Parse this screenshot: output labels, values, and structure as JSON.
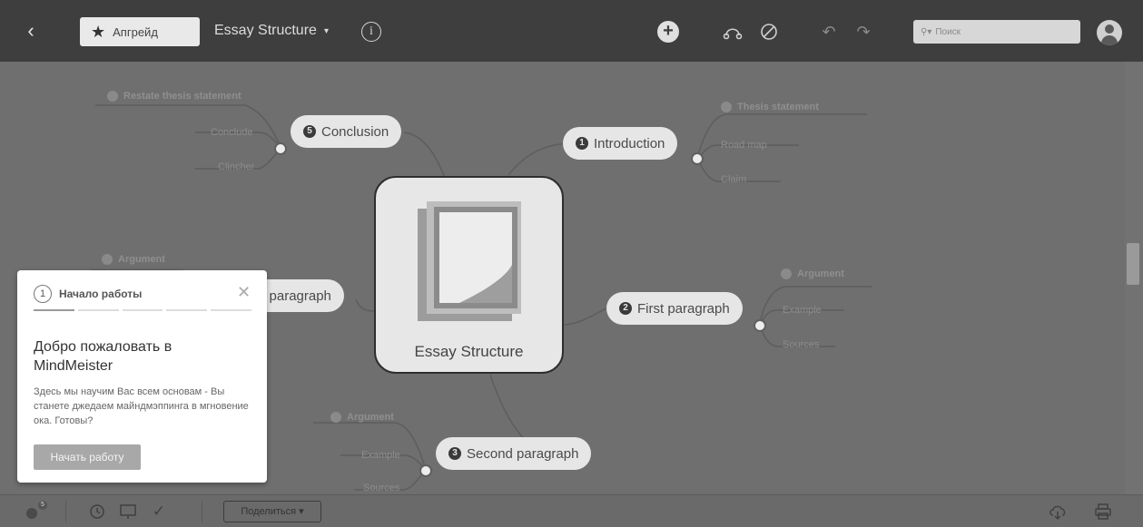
{
  "topbar": {
    "back_icon": "chevron-left-icon",
    "upgrade_label": "Апгрейд",
    "map_title": "Essay Structure",
    "title_caret": "▾",
    "info_icon": "info-icon",
    "add_icon": "plus-circle-icon",
    "search_placeholder": "Поиск",
    "icons": [
      "connect-icon",
      "no-entry-icon",
      "undo-icon",
      "redo-icon"
    ]
  },
  "mindmap": {
    "central_label": "Essay Structure",
    "branches": {
      "conclusion": {
        "num": "5",
        "label": "Conclusion",
        "head": "Restate thesis statement",
        "leaves": [
          "Conclude",
          "Clincher"
        ]
      },
      "introduction": {
        "num": "1",
        "label": "Introduction",
        "head": "Thesis statement",
        "leaves": [
          "Road map",
          "Claim"
        ]
      },
      "first": {
        "num": "2",
        "label": "First paragraph",
        "head": "Argument",
        "leaves": [
          "Example",
          "Sources"
        ]
      },
      "second": {
        "num": "3",
        "label": "Second paragraph",
        "head": "Argument",
        "leaves": [
          "Example",
          "Sources"
        ]
      },
      "third": {
        "label": "d paragraph",
        "head": "Argument"
      }
    }
  },
  "onboarding": {
    "step_number": "1",
    "step_title": "Начало работы",
    "close_glyph": "✕",
    "progress_total": 5,
    "progress_current": 1,
    "welcome": "Добро пожаловать в MindMeister",
    "description": "Здесь мы научим Вас всем основам - Вы станете джедаем майндмэппинга в мгновение ока. Готовы?",
    "start_label": "Начать работу"
  },
  "bottombar": {
    "share_label": "Поделиться ▾",
    "badge": "5",
    "icons": [
      "points-icon",
      "history-icon",
      "presentation-icon",
      "check-icon",
      "cloud-download-icon",
      "print-icon"
    ]
  }
}
